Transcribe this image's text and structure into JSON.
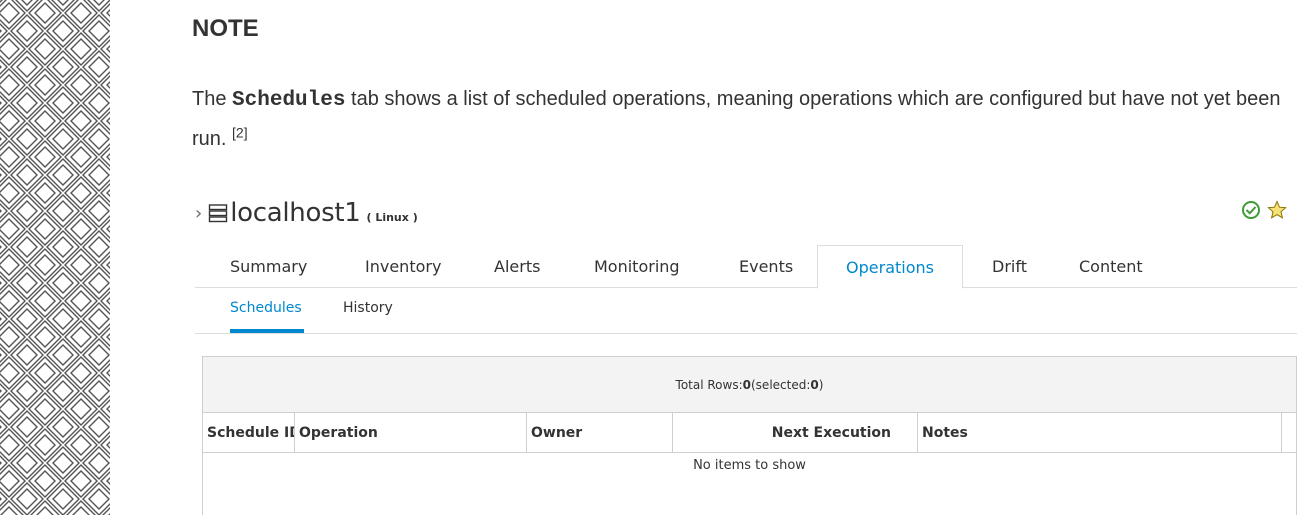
{
  "note": {
    "title": "NOTE",
    "para_pre": "The ",
    "para_code": "Schedules",
    "para_post": " tab shows a list of scheduled operations, meaning operations which are configured but have not yet been run. ",
    "footnote": "[2]"
  },
  "resource": {
    "name": "localhost1",
    "type": "( Linux )",
    "icons": [
      "chevron-right-icon",
      "server-icon",
      "availability-check-icon",
      "favorite-star-icon"
    ],
    "colors": {
      "available": "#3f9c35",
      "star": "#f0c419",
      "accent": "#0088ce"
    }
  },
  "tabs": [
    {
      "label": "Summary"
    },
    {
      "label": "Inventory"
    },
    {
      "label": "Alerts"
    },
    {
      "label": "Monitoring"
    },
    {
      "label": "Events"
    },
    {
      "label": "Operations",
      "active": true
    },
    {
      "label": "Drift"
    },
    {
      "label": "Content"
    }
  ],
  "subtabs": [
    {
      "label": "Schedules",
      "active": true
    },
    {
      "label": "History"
    }
  ],
  "grid": {
    "total_rows_label": "Total Rows: ",
    "total_rows_value": "0",
    "selected_label": " (selected: ",
    "selected_value": "0",
    "selected_close": ")",
    "columns": [
      "Schedule ID",
      "Operation",
      "Owner",
      "Next Execution",
      "Notes"
    ],
    "empty_text": "No items to show"
  }
}
